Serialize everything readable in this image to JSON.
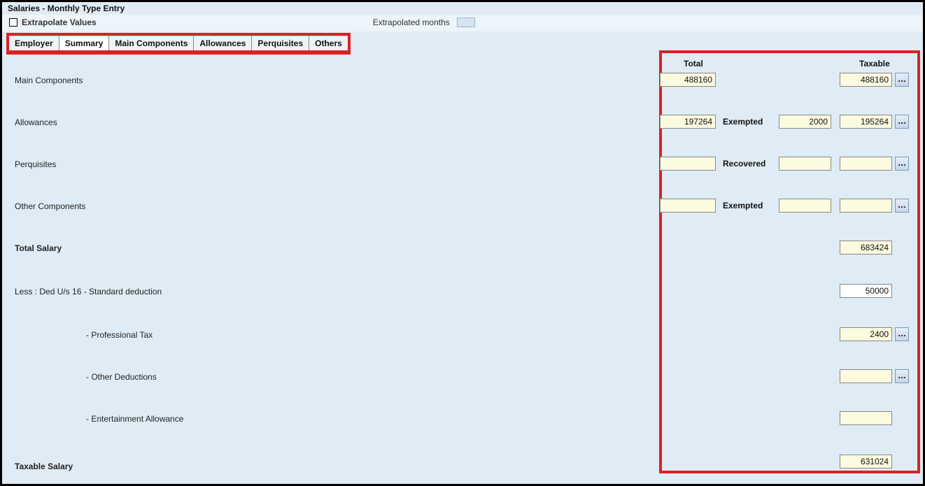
{
  "title": "Salaries - Monthly Type Entry",
  "top": {
    "extrapolate_label": "Extrapolate Values",
    "extrapolated_months_label": "Extrapolated months"
  },
  "tabs": {
    "employer": "Employer",
    "summary": "Summary",
    "main_components": "Main Components",
    "allowances": "Allowances",
    "perquisites": "Perquisites",
    "others": "Others"
  },
  "col_headers": {
    "total": "Total",
    "taxable": "Taxable"
  },
  "rows": {
    "main_components": {
      "label": "Main Components",
      "total": "488160",
      "taxable": "488160"
    },
    "allowances": {
      "label": "Allowances",
      "total": "197264",
      "mid_label": "Exempted",
      "mid_value": "2000",
      "taxable": "195264"
    },
    "perquisites": {
      "label": "Perquisites",
      "total": "",
      "mid_label": "Recovered",
      "mid_value": "",
      "taxable": ""
    },
    "other_components": {
      "label": "Other Components",
      "total": "",
      "mid_label": "Exempted",
      "mid_value": "",
      "taxable": ""
    },
    "total_salary": {
      "label": "Total Salary",
      "taxable": "683424"
    },
    "std_ded": {
      "label": "Less : Ded U/s 16 - Standard deduction",
      "value": "50000"
    },
    "prof_tax": {
      "label": "- Professional Tax",
      "value": "2400"
    },
    "other_ded": {
      "label": "- Other Deductions",
      "value": ""
    },
    "ent_allow": {
      "label": "- Entertainment Allowance",
      "value": ""
    },
    "taxable_salary": {
      "label": "Taxable Salary",
      "value": "631024"
    }
  },
  "dots": "..."
}
